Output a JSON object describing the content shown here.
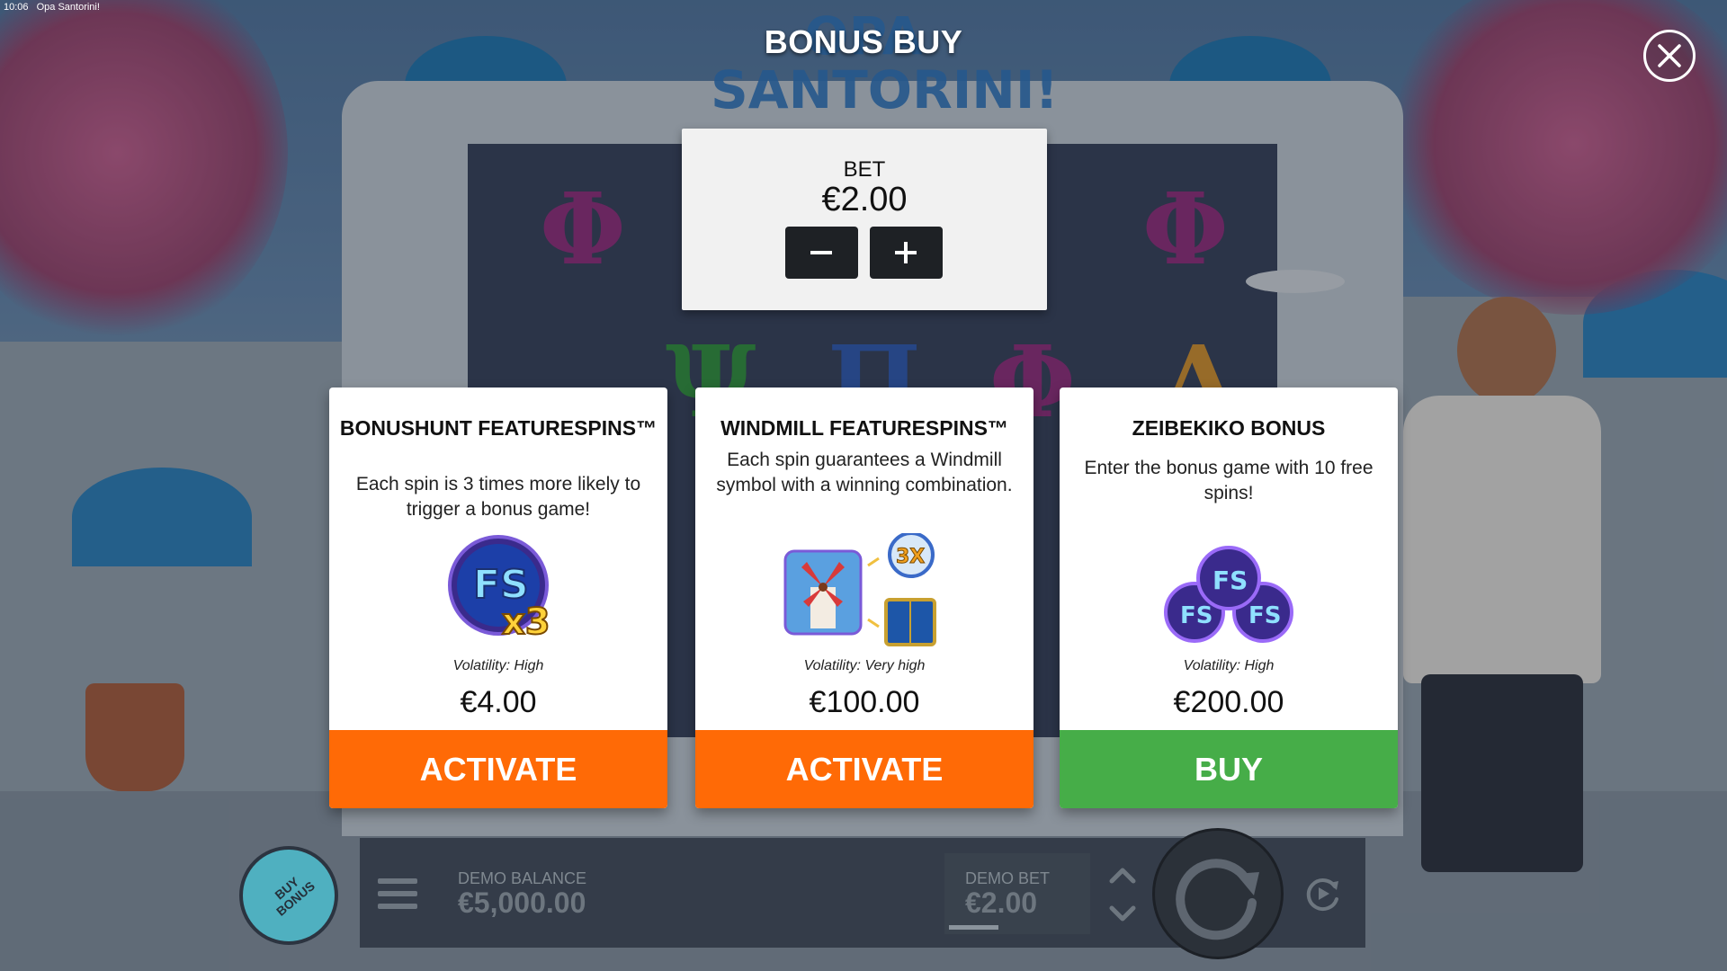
{
  "status_bar": {
    "time": "10:06",
    "app_name": "Opa Santorini!"
  },
  "game_logo": {
    "line1": "OPA",
    "line2": "SANTORINI!"
  },
  "dialog": {
    "title": "BONUS BUY",
    "close_icon": "close-icon"
  },
  "bet_selector": {
    "label": "BET",
    "value": "€2.00",
    "decrease_icon": "minus-icon",
    "increase_icon": "plus-icon"
  },
  "cards": [
    {
      "title": "BONUSHUNT FEATURESPINS™",
      "description": "Each spin is 3 times more likely to trigger a bonus game!",
      "icon": "fs-x3-icon",
      "icon_text": "FS",
      "icon_mult": "x3",
      "volatility": "Volatility: High",
      "price": "€4.00",
      "action": "ACTIVATE",
      "action_color": "#ff6a06"
    },
    {
      "title": "WINDMILL FEATURESPINS™",
      "description": "Each spin guarantees a Windmill symbol with a winning combination.",
      "icon": "windmill-icon",
      "icon_mult": "3X",
      "volatility": "Volatility: Very high",
      "price": "€100.00",
      "action": "ACTIVATE",
      "action_color": "#ff6a06"
    },
    {
      "title": "ZEIBEKIKO BONUS",
      "description": "Enter the bonus game with 10 free spins!",
      "icon": "fs-coins-icon",
      "icon_text": "FS",
      "volatility": "Volatility: High",
      "price": "€200.00",
      "action": "BUY",
      "action_color": "#46ad48"
    }
  ],
  "reel_symbols": [
    "Φ",
    "Φ",
    "Φ",
    "Ψ",
    "Π",
    "Λ"
  ],
  "bottom_bar": {
    "buy_bonus": "BUY BONUS",
    "menu_icon": "hamburger-menu-icon",
    "balance_label": "DEMO BALANCE",
    "balance_value": "€5,000.00",
    "bet_label": "DEMO BET",
    "bet_value": "€2.00",
    "bet_adjust_icon": "chevron-up-down-icon",
    "spin_icon": "spin-icon",
    "autoplay_icon": "autoplay-icon"
  }
}
